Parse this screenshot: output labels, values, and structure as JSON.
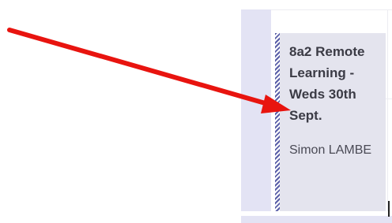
{
  "event": {
    "title": "8a2 Remote Learning - Weds 30th Sept.",
    "organizer": "Simon LAMBE"
  },
  "colors": {
    "event_background": "#e4e4ee",
    "stripe": "#5a5fa8",
    "day_strip": "#e3e3f4",
    "annotation_arrow": "#e8140f"
  }
}
